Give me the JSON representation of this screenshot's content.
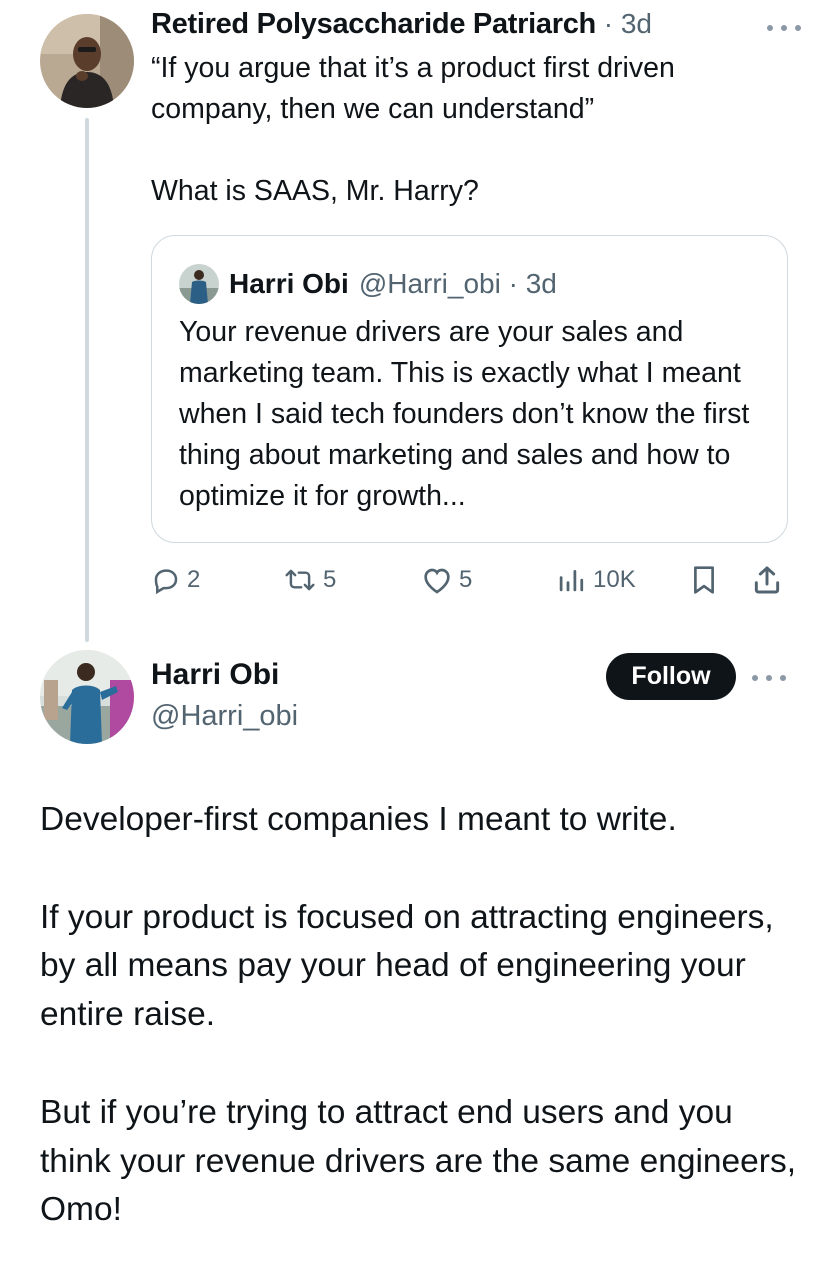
{
  "reply_context": {
    "author_name": "Retired Polysaccharide Patriarch",
    "separator": " · ",
    "time": "3d",
    "more_icon": "more-horizontal-icon",
    "text": "“If you argue that it’s a product first driven company, then we can understand”\n\nWhat is SAAS, Mr. Harry?",
    "quoted": {
      "author_name": "Harri Obi",
      "handle": "@Harri_obi",
      "separator": " · ",
      "time": "3d",
      "text": "Your revenue drivers are your sales and marketing team. This is exactly what I meant when I said tech founders don’t know the first thing about marketing and sales and how to optimize it for growth..."
    },
    "actions": {
      "replies": "2",
      "reposts": "5",
      "likes": "5",
      "views": "10K"
    }
  },
  "main_tweet": {
    "author_name": "Harri Obi",
    "handle": "@Harri_obi",
    "follow_label": "Follow",
    "text": "Developer-first companies I meant to write.\n\nIf your product is focused on attracting engineers, by all means pay your head of engineering your entire raise.\n\nBut if you’re trying to attract end users and you think your revenue drivers are the same engineers, Omo!"
  },
  "colors": {
    "text_primary": "#0f1419",
    "text_secondary": "#536471",
    "border": "#cfd9de",
    "follow_bg": "#0f1419"
  }
}
